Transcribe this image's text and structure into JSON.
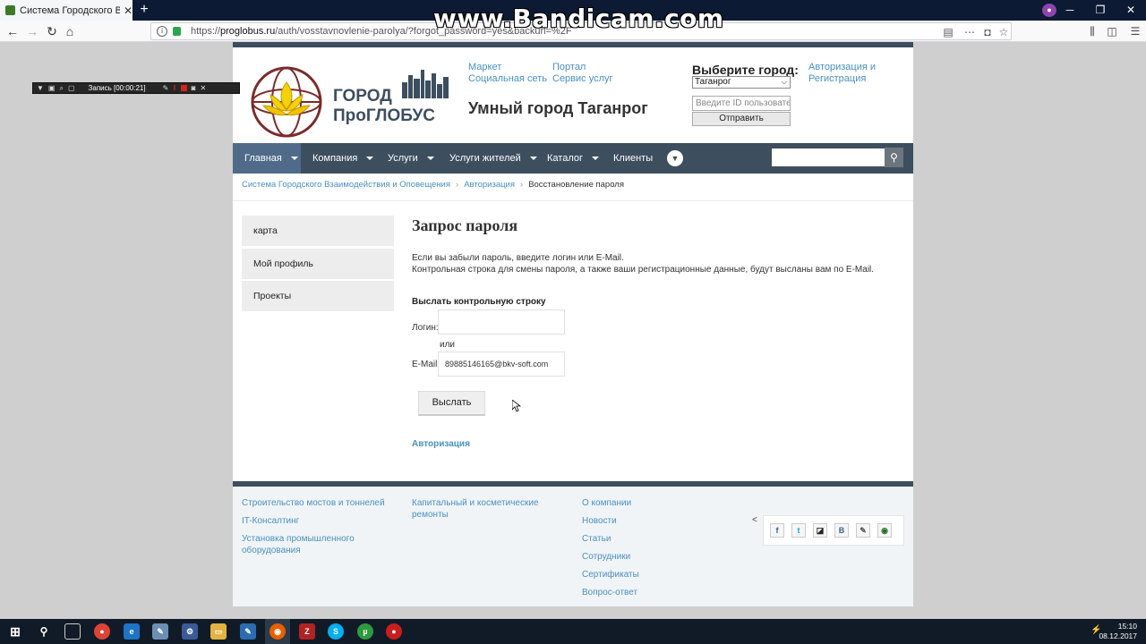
{
  "browser": {
    "tab_title": "Система Городского Взаимод",
    "url_prefix": "https://",
    "url_domain": "proglobus.ru",
    "url_path": "/auth/vosstavnovlenie-parolya/?forgot_password=yes&backurl=%2F",
    "watermark": "www.Bandicam.com"
  },
  "recorder": {
    "label": "Запись [00:00:21]"
  },
  "header": {
    "logo_line1": "ГОРОД",
    "logo_line2": "ПроГЛОБУС",
    "links": [
      "Маркет",
      "Социальная сеть",
      "Портал",
      "Сервис услуг"
    ],
    "smart_city": "Умный город Таганрог",
    "city_label": "Выберите город:",
    "city_selected": "Таганрог",
    "id_placeholder": "Введите ID пользователя",
    "submit_label": "Отправить",
    "auth_link": "Авторизация и Регистрация"
  },
  "menu": {
    "items": [
      "Главная",
      "Компания",
      "Услуги",
      "Услуги жителей",
      "Каталог",
      "Клиенты"
    ]
  },
  "breadcrumb": {
    "items": [
      "Система Городского Взаимодействия и Оповещения",
      "Авторизация",
      "Восстановление пароля"
    ]
  },
  "sidebar": {
    "items": [
      "карта",
      "Мой профиль",
      "Проекты"
    ]
  },
  "main": {
    "title": "Запрос пароля",
    "intro_line1": "Если вы забыли пароль, введите логин или E-Mail.",
    "intro_line2": "Контрольная строка для смены пароля, а также ваши регистрационные данные, будут высланы вам по E-Mail.",
    "form_heading": "Выслать контрольную строку",
    "login_label": "Логин:",
    "login_value": "",
    "or_text": "или",
    "email_label": "E-Mail:",
    "email_value": "89885146165@bkv-soft.com",
    "send_label": "Выслать",
    "auth_link": "Авторизация"
  },
  "footer": {
    "col1": [
      "Строительство мостов и тоннелей",
      "IT-Консалтинг",
      "Установка промышленного оборудования"
    ],
    "col2": [
      "Капитальный и косметические ремонты"
    ],
    "col3": [
      "О компании",
      "Новости",
      "Статьи",
      "Сотрудники",
      "Сертификаты",
      "Вопрос-ответ"
    ],
    "social_icons": [
      "facebook-icon",
      "twitter-icon",
      "delicious-icon",
      "vk-icon",
      "livejournal-icon",
      "odnoklassniki-icon"
    ]
  },
  "taskbar": {
    "time": "15:10",
    "date": "08.12.2017"
  },
  "colors": {
    "menu_bg": "#3d4e5f",
    "menu_active": "#4f6b89",
    "link": "#4a90c2"
  }
}
